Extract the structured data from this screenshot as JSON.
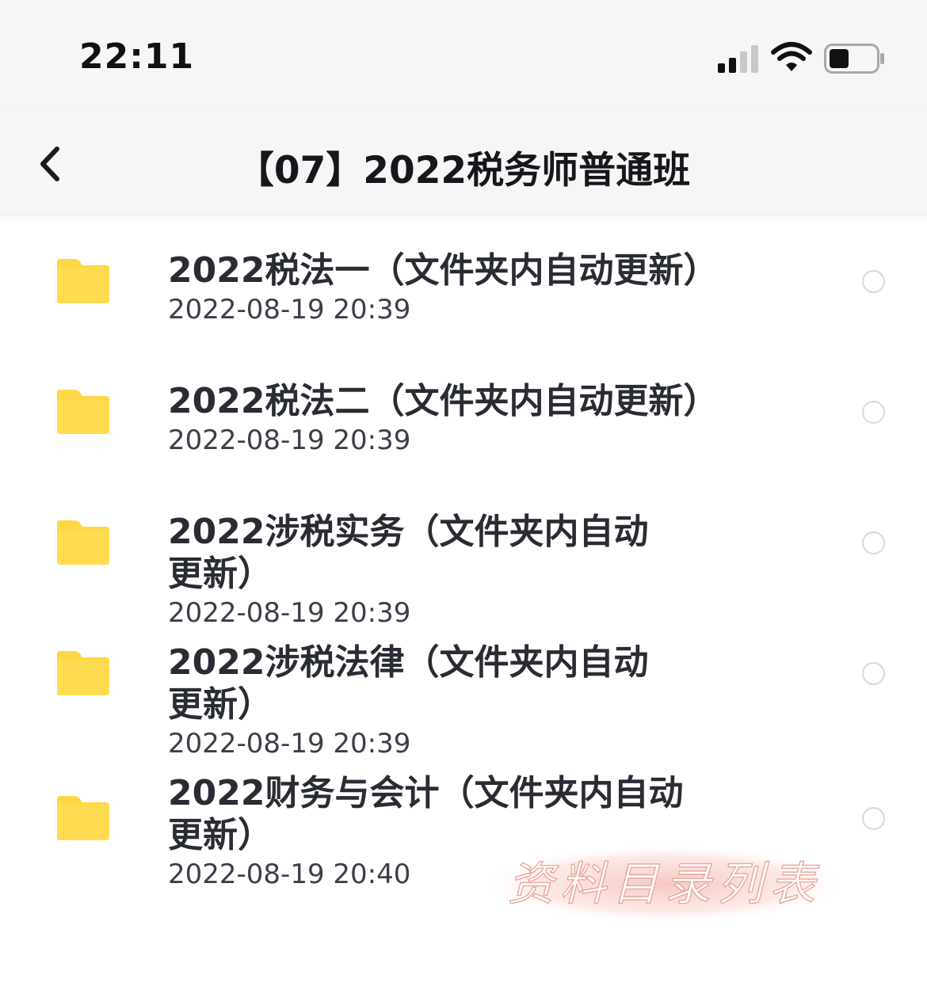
{
  "status_bar": {
    "time": "22:11"
  },
  "nav": {
    "title": "【07】2022税务师普通班"
  },
  "items": [
    {
      "name": "2022税法一（文件夹内自动更新）",
      "date": "2022-08-19 20:39"
    },
    {
      "name": "2022税法二（文件夹内自动更新）",
      "date": "2022-08-19 20:39"
    },
    {
      "name": "2022涉税实务（文件夹内自动更新）",
      "date": "2022-08-19 20:39"
    },
    {
      "name": "2022涉税法律（文件夹内自动更新）",
      "date": "2022-08-19 20:39"
    },
    {
      "name": "2022财务与会计（文件夹内自动更新）",
      "date": "2022-08-19 20:40"
    }
  ],
  "watermark": {
    "text": "资料目录列表"
  },
  "colors": {
    "folder": "#ffd645",
    "radio_border": "#d7d8dc",
    "bar_background": "#f6f6f7"
  }
}
